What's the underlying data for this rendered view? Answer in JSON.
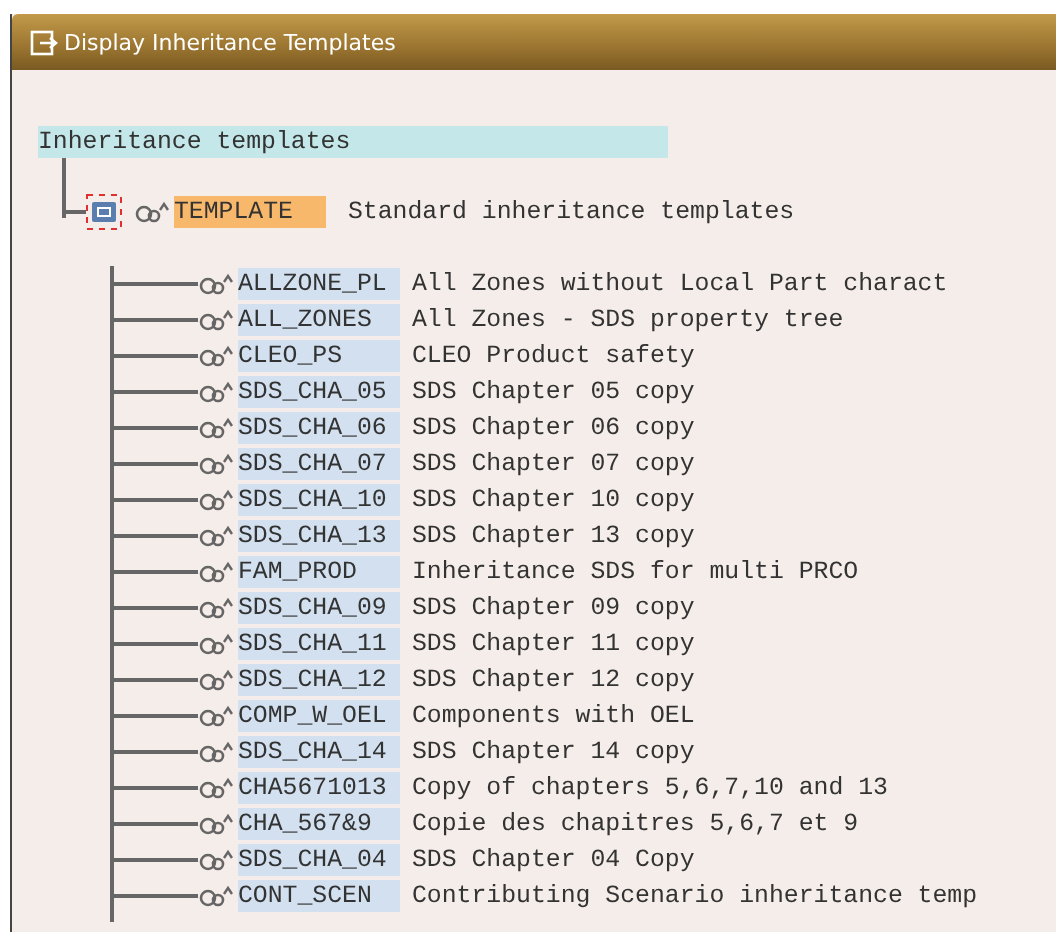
{
  "window": {
    "title": "Display Inheritance Templates"
  },
  "tree": {
    "root": {
      "label": "Inheritance templates"
    },
    "nodes": [
      {
        "code": "TEMPLATE",
        "description": "Standard inheritance templates",
        "selected": true,
        "expanded": true,
        "children": [
          {
            "code": "ALLZONE_PL",
            "description": "All Zones without Local Part charact",
            "selected": false
          },
          {
            "code": "ALL_ZONES",
            "description": "All Zones - SDS property tree",
            "selected": false
          },
          {
            "code": "CLEO_PS",
            "description": "CLEO Product safety",
            "selected": false
          },
          {
            "code": "SDS_CHA_05",
            "description": "SDS Chapter 05 copy",
            "selected": false
          },
          {
            "code": "SDS_CHA_06",
            "description": "SDS Chapter 06 copy",
            "selected": false
          },
          {
            "code": "SDS_CHA_07",
            "description": "SDS Chapter 07 copy",
            "selected": false
          },
          {
            "code": "SDS_CHA_10",
            "description": "SDS Chapter 10 copy",
            "selected": false
          },
          {
            "code": "SDS_CHA_13",
            "description": "SDS Chapter 13 copy",
            "selected": false
          },
          {
            "code": "FAM_PROD",
            "description": "Inheritance SDS for multi PRCO",
            "selected": false
          },
          {
            "code": "SDS_CHA_09",
            "description": "SDS Chapter 09 copy",
            "selected": false
          },
          {
            "code": "SDS_CHA_11",
            "description": "SDS Chapter 11 copy",
            "selected": false
          },
          {
            "code": "SDS_CHA_12",
            "description": "SDS Chapter 12 copy",
            "selected": false
          },
          {
            "code": "COMP_W_OEL",
            "description": "Components with OEL",
            "selected": false
          },
          {
            "code": "SDS_CHA_14",
            "description": "SDS Chapter 14 copy",
            "selected": false
          },
          {
            "code": "CHA5671013",
            "description": "Copy of chapters 5,6,7,10 and 13",
            "selected": false
          },
          {
            "code": "CHA_567&9",
            "description": "Copie des chapitres 5,6,7 et 9",
            "selected": false
          },
          {
            "code": "SDS_CHA_04",
            "description": "SDS Chapter 04 Copy",
            "selected": false
          },
          {
            "code": "CONT_SCEN",
            "description": "Contributing Scenario inheritance temp",
            "selected": false
          }
        ]
      }
    ]
  }
}
